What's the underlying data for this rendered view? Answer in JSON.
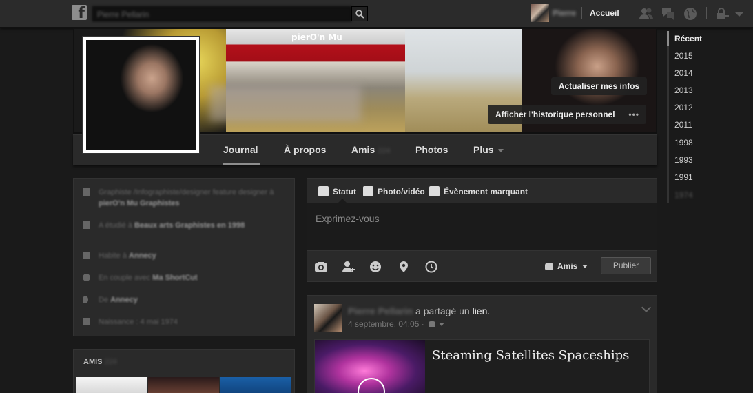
{
  "topbar": {
    "search_placeholder": "Pierre Pellarin",
    "user_name": "Pierre",
    "home_label": "Accueil"
  },
  "cover": {
    "sign_text": "pierO'n Mu",
    "update_info_label": "Actualiser mes infos",
    "activity_log_label": "Afficher l'historique personnel",
    "activity_log_more": "•••"
  },
  "nav": {
    "journal": "Journal",
    "about": "À propos",
    "friends": "Amis",
    "friends_count": "224",
    "photos": "Photos",
    "more": "Plus"
  },
  "about": {
    "rows": [
      {
        "icon": "briefcase-icon",
        "prefix": "Graphiste /Infographiste/designer feature designer à",
        "bold": "pierO'n Mu Graphistes"
      },
      {
        "icon": "school-icon",
        "prefix": "A étudié à",
        "bold": "Beaux arts Graphistes en 1998"
      },
      {
        "icon": "home-icon",
        "prefix": "Habite à",
        "bold": "Annecy"
      },
      {
        "icon": "heart-icon",
        "prefix": "En couple avec",
        "bold": "Ma ShortCut"
      },
      {
        "icon": "location-icon",
        "prefix": "De",
        "bold": "Annecy"
      },
      {
        "icon": "calendar-icon",
        "prefix": "Naissance : 4 mai 1974",
        "bold": ""
      }
    ]
  },
  "friends_card": {
    "heading": "AMIS",
    "count": "224"
  },
  "composer": {
    "tab_status": "Statut",
    "tab_photo": "Photo/vidéo",
    "tab_event": "Évènement marquant",
    "placeholder": "Exprimez-vous",
    "audience": "Amis",
    "publish": "Publier"
  },
  "story": {
    "author": "Pierre Pellarin",
    "action": " a partagé un ",
    "link_word": "lien",
    "period": ".",
    "meta": "4 septembre, 04:05 ·",
    "link_title": "Steaming Satellites Spaceships"
  },
  "scrubber": {
    "items": [
      "Récent",
      "2015",
      "2014",
      "2013",
      "2012",
      "2011",
      "1998",
      "1993",
      "1991",
      "1974"
    ]
  },
  "colors": {
    "background": "#1a1a1a",
    "card": "#2a2a2a",
    "topbar": "#2b2b2b"
  }
}
